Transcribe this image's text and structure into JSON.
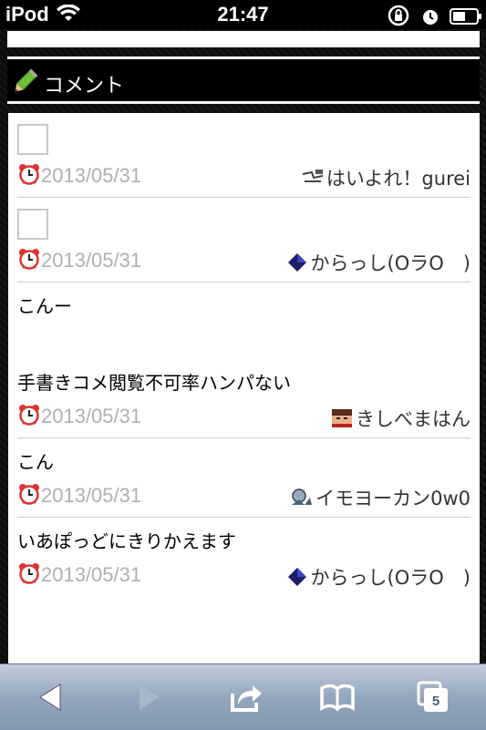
{
  "status_bar": {
    "carrier": "iPod",
    "time": "21:47"
  },
  "header": {
    "title": "コメント"
  },
  "comments": [
    {
      "body": "",
      "has_image": true,
      "date": "2013/05/31",
      "author": "はいよれ！gurei",
      "avatar": "drawing-avatar"
    },
    {
      "body": "",
      "has_image": true,
      "date": "2013/05/31",
      "author": "からっし(OラO　)",
      "avatar": "diamond-avatar"
    },
    {
      "body": "こんー\n\n\n手書きコメ閲覧不可率ハンパない",
      "has_image": false,
      "date": "2013/05/31",
      "author": "きしべまはん",
      "avatar": "face-avatar"
    },
    {
      "body": "こん",
      "has_image": false,
      "date": "2013/05/31",
      "author": "イモヨーカン0w0",
      "avatar": "drawing-avatar"
    },
    {
      "body": "いあぽっどにきりかえます",
      "has_image": false,
      "date": "2013/05/31",
      "author": "からっし(OラO　)",
      "avatar": "diamond-avatar"
    }
  ],
  "toolbar": {
    "tab_count": "5"
  }
}
